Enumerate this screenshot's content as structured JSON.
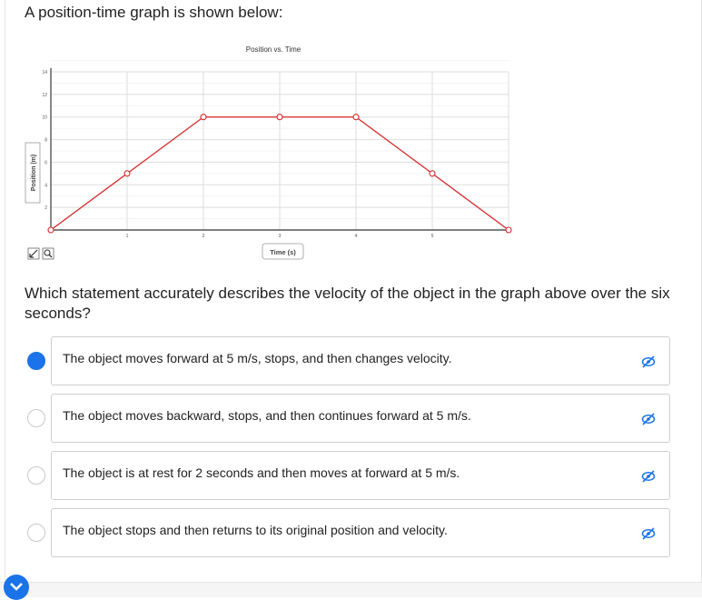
{
  "prompt": "A position-time graph is shown below:",
  "question": "Which statement accurately describes the velocity of the object in the graph above over the six seconds?",
  "choices": [
    {
      "text": "The object moves forward at 5 m/s, stops, and then changes velocity.",
      "selected": true
    },
    {
      "text": "The object moves backward, stops, and then continues forward at 5 m/s.",
      "selected": false
    },
    {
      "text": "The object is at rest for 2 seconds and then moves at forward at 5 m/s.",
      "selected": false
    },
    {
      "text": "The object stops and then returns to its original position and velocity.",
      "selected": false
    }
  ],
  "colors": {
    "accent": "#1a73e8",
    "series": "#d62728",
    "border": "#cfcfcf"
  },
  "icons": {
    "eliminate": "eye-slash-icon",
    "zoom": "zoom-icon",
    "draw": "pencil-icon",
    "next": "chevron-down-icon"
  },
  "chart_data": {
    "type": "line",
    "title": "Position vs. Time",
    "xlabel": "Time (s)",
    "ylabel": "Position (m)",
    "xlim": [
      0,
      6
    ],
    "ylim": [
      0,
      14
    ],
    "xticks": [
      "",
      "1",
      "2",
      "3",
      "4",
      "5",
      ""
    ],
    "yticks": [
      "",
      "2",
      "4",
      "6",
      "8",
      "10",
      "12",
      "14"
    ],
    "grid": true,
    "series": [
      {
        "x": [
          0,
          1,
          2,
          3,
          4,
          5,
          6
        ],
        "y": [
          0,
          5,
          10,
          10,
          10,
          5,
          0
        ]
      }
    ]
  }
}
